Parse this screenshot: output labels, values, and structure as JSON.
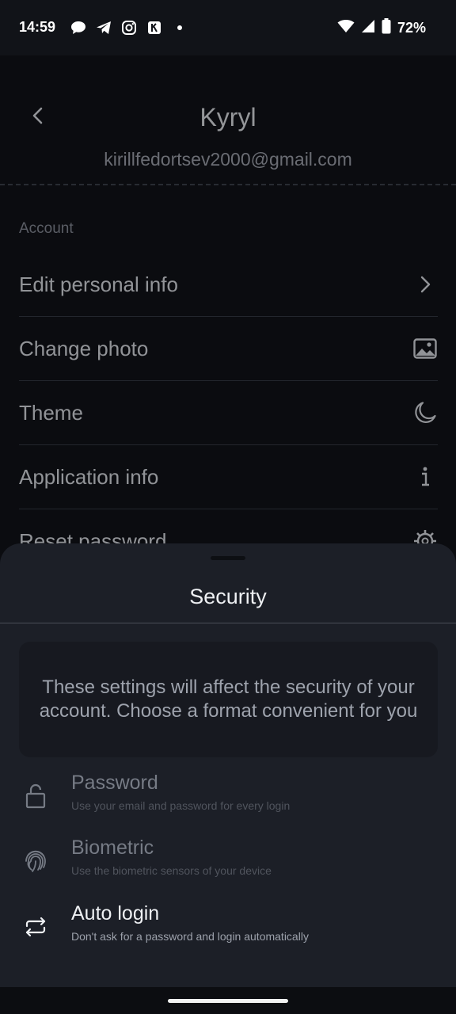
{
  "status_bar": {
    "time": "14:59",
    "battery": "72%",
    "left_icons": [
      "chat-bubble-icon",
      "telegram-icon",
      "instagram-icon",
      "app-notification-icon",
      "dot-icon"
    ],
    "right_icons": [
      "wifi-icon",
      "signal-icon",
      "battery-icon"
    ]
  },
  "profile": {
    "name": "Kyryl",
    "email": "kirillfedortsev2000@gmail.com"
  },
  "account": {
    "section_label": "Account",
    "items": [
      {
        "label": "Edit personal info",
        "icon": "chevron-right-icon"
      },
      {
        "label": "Change photo",
        "icon": "image-icon"
      },
      {
        "label": "Theme",
        "icon": "moon-icon"
      },
      {
        "label": "Application info",
        "icon": "info-icon"
      },
      {
        "label": "Reset password",
        "icon": "gear-icon"
      }
    ]
  },
  "security_sheet": {
    "title": "Security",
    "info_text": "These settings will affect the security of your account. Choose a format convenient for you",
    "options": [
      {
        "title": "Password",
        "description": "Use your email and password for every login",
        "icon": "unlock-icon",
        "state": "disabled"
      },
      {
        "title": "Biometric",
        "description": "Use the biometric sensors of your device",
        "icon": "fingerprint-icon",
        "state": "disabled"
      },
      {
        "title": "Auto login",
        "description": "Don't ask for a password and login automatically",
        "icon": "repeat-icon",
        "state": "active"
      }
    ]
  },
  "colors": {
    "background": "#0b0c10",
    "sheet": "#1c1f27",
    "info_box": "#171920",
    "text_primary": "#eef0f3",
    "text_muted": "#767b85"
  }
}
